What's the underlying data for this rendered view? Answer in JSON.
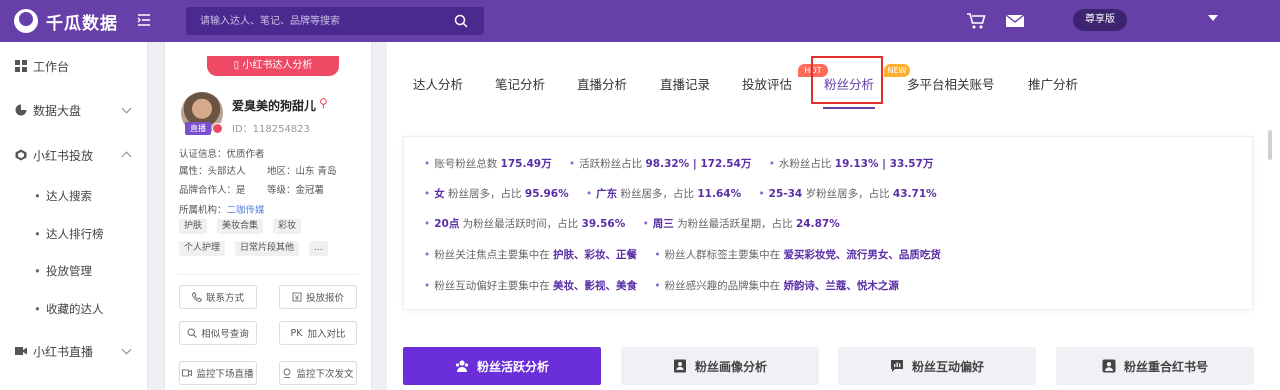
{
  "app": {
    "logo_text": "千瓜数据",
    "search_placeholder": "请输入达人、笔记、品牌等搜索",
    "vip_label": "尊享版",
    "accent": "#6640a8"
  },
  "sidebar": {
    "items": [
      {
        "label": "工作台",
        "icon": "grid-icon"
      },
      {
        "label": "数据大盘",
        "icon": "pie-chart-icon"
      },
      {
        "label": "小红书投放",
        "icon": "cube-icon"
      },
      {
        "label": "小红书直播",
        "icon": "video-icon"
      }
    ],
    "sub_items": [
      "达人搜索",
      "达人排行榜",
      "投放管理",
      "收藏的达人"
    ]
  },
  "profile": {
    "banner": "小红书达人分析",
    "name": "爱臭美的狗甜儿",
    "id_text": "ID：118254823",
    "live_badge": "直播",
    "verify": "认证信息：优质作者",
    "attr": "属性：头部达人",
    "region": "地区：山东 青岛",
    "brand_partner": "品牌合作人：是",
    "level": "等级：金冠薯",
    "org_label": "所属机构：",
    "org_value": "二咖传媒",
    "tags": [
      "护肤",
      "美妆合集",
      "彩妆",
      "个人护理",
      "日常片段其他",
      "..."
    ],
    "buttons": [
      "联系方式",
      "投放报价",
      "相似号查询",
      "加入对比",
      "监控下场直播",
      "监控下次发文"
    ],
    "pk_prefix": "PK"
  },
  "tabs": {
    "items": [
      "达人分析",
      "笔记分析",
      "直播分析",
      "直播记录",
      "投放评估",
      "粉丝分析",
      "多平台相关账号",
      "推广分析"
    ],
    "active": "粉丝分析",
    "hot_badge": "HOT",
    "new_badge": "NEW"
  },
  "summary": {
    "r1": {
      "a_label": "账号粉丝总数",
      "a_val": "175.49万",
      "b_label": "活跃粉丝占比",
      "b_val": "98.32% | 172.54万",
      "c_label": "水粉丝占比",
      "c_val": "19.13% | 33.57万"
    },
    "r2": {
      "a_key": "女",
      "a_text": "粉丝居多，占比",
      "a_val": "95.96%",
      "b_key": "广东",
      "b_text": "粉丝居多，占比",
      "b_val": "11.64%",
      "c_key": "25-34",
      "c_text": "岁粉丝居多，占比",
      "c_val": "43.71%"
    },
    "r3": {
      "a_key": "20点",
      "a_text": "为粉丝最活跃时间，占比",
      "a_val": "39.56%",
      "b_key": "周三",
      "b_text": "为粉丝最活跃星期，占比",
      "b_val": "24.87%"
    },
    "r4": {
      "a_text": "粉丝关注焦点主要集中在",
      "a_val": "护肤、彩妆、正餐",
      "b_text": "粉丝人群标签主要集中在",
      "b_val": "爱买彩妆党、流行男女、品质吃货"
    },
    "r5": {
      "a_text": "粉丝互动偏好主要集中在",
      "a_val": "美妆、影视、美食",
      "b_text": "粉丝感兴趣的品牌集中在",
      "b_val": "娇韵诗、兰蔻、悦木之源"
    }
  },
  "section_buttons": [
    "粉丝活跃分析",
    "粉丝画像分析",
    "粉丝互动偏好",
    "粉丝重合红书号"
  ]
}
